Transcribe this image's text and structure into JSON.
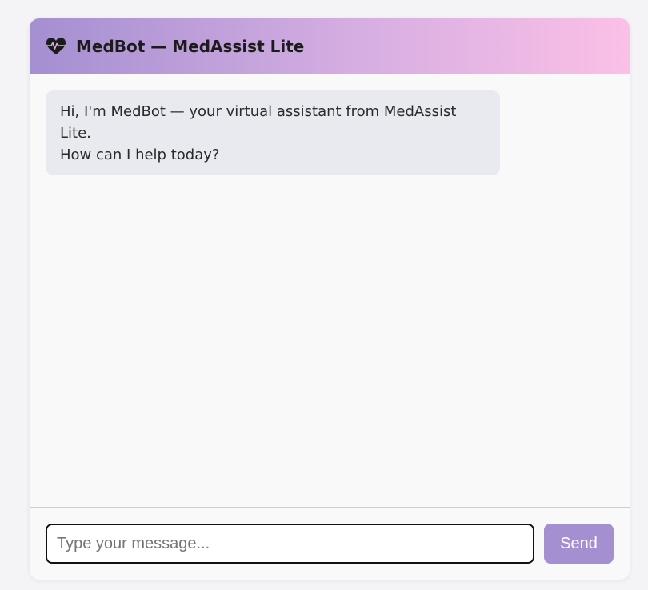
{
  "header": {
    "icon": "heart-pulse-icon",
    "title": "MedBot — MedAssist Lite"
  },
  "messages": [
    {
      "sender": "bot",
      "lines": [
        "Hi, I'm MedBot — your virtual assistant from MedAssist Lite.",
        "How can I help today?"
      ]
    }
  ],
  "composer": {
    "input_value": "",
    "input_placeholder": "Type your message...",
    "send_label": "Send"
  },
  "colors": {
    "accent": "#a48fd1",
    "header_gradient_start": "#a48fd1",
    "header_gradient_end": "#fbc0e6",
    "bubble_bg": "#e9e9f0"
  }
}
